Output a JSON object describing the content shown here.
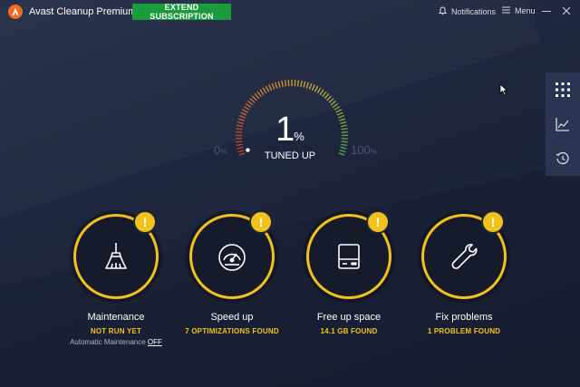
{
  "titlebar": {
    "app_title": "Avast Cleanup Premium",
    "extend_label": "EXTEND SUBSCRIPTION",
    "notifications_label": "Notifications",
    "menu_label": "Menu"
  },
  "gauge": {
    "value": "1",
    "unit": "%",
    "label": "TUNED UP",
    "min_label": "0",
    "max_label": "100",
    "percent_sign": "%",
    "level": 0.01
  },
  "side_panel": {
    "items": [
      {
        "icon": "grid-icon"
      },
      {
        "icon": "chart-icon"
      },
      {
        "icon": "history-icon"
      }
    ]
  },
  "cards": [
    {
      "title": "Maintenance",
      "status": "NOT RUN YET",
      "extra_text": "Automatic Maintenance",
      "extra_link": "OFF",
      "icon": "broom-icon"
    },
    {
      "title": "Speed up",
      "status": "7 OPTIMIZATIONS FOUND",
      "icon": "speedometer-icon"
    },
    {
      "title": "Free up space",
      "status": "14.1 GB FOUND",
      "icon": "hard-drive-icon"
    },
    {
      "title": "Fix problems",
      "status": "1 PROBLEM FOUND",
      "icon": "wrench-icon"
    }
  ],
  "badge_symbol": "!",
  "colors": {
    "accent_yellow": "#f1c21b",
    "brand_orange": "#f26b23",
    "button_green": "#1a9b3c",
    "background": "#1e2539"
  }
}
